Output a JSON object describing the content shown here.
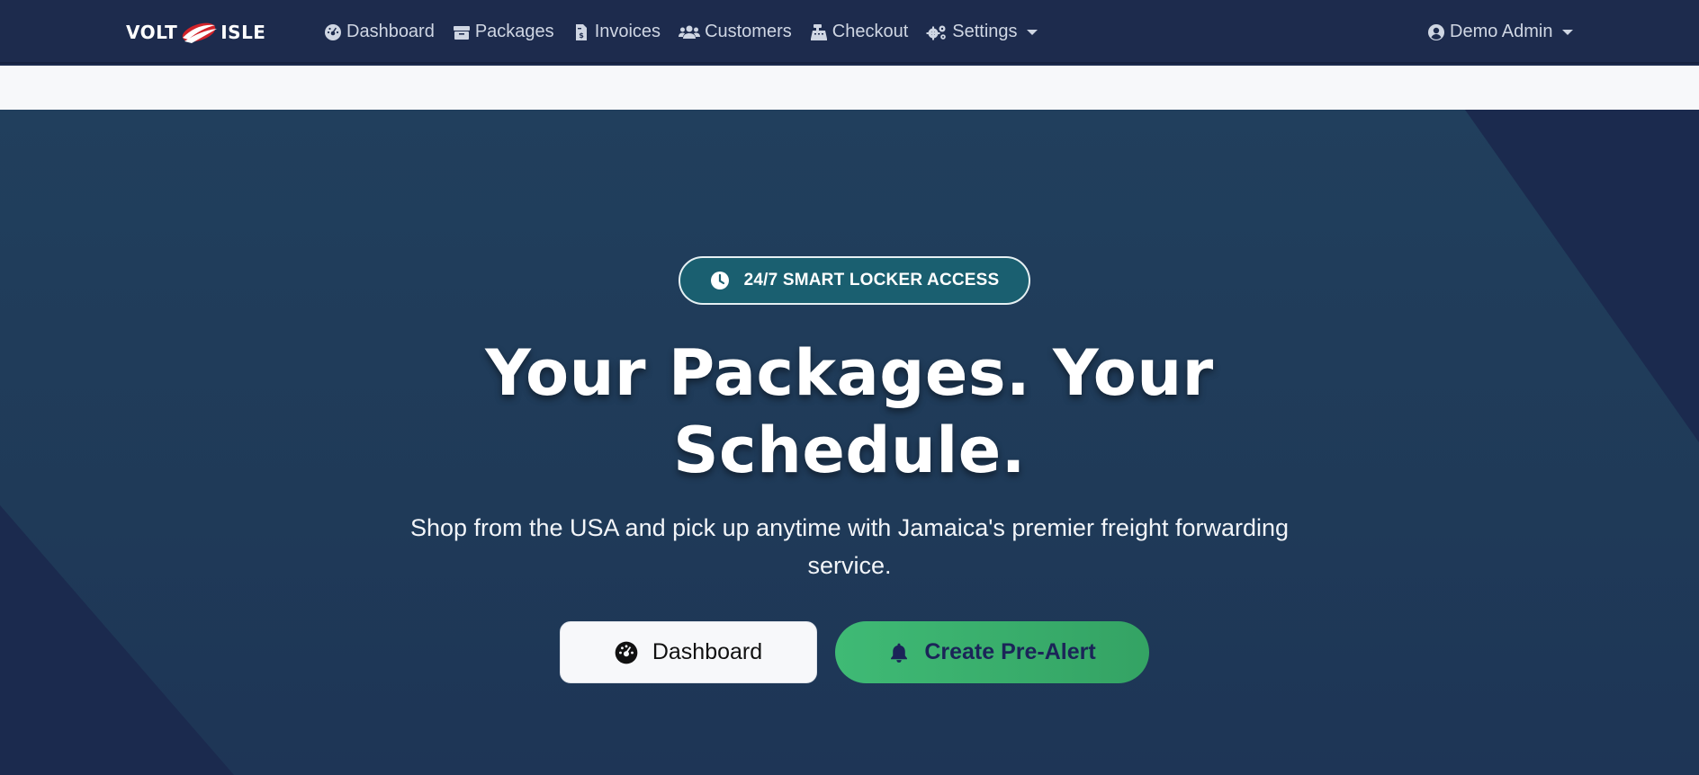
{
  "navbar": {
    "brand_left": "VOLT",
    "brand_right": "ISLE",
    "links": [
      {
        "label": "Dashboard",
        "icon": "gauge-icon"
      },
      {
        "label": "Packages",
        "icon": "box-icon"
      },
      {
        "label": "Invoices",
        "icon": "invoice-icon"
      },
      {
        "label": "Customers",
        "icon": "users-icon"
      },
      {
        "label": "Checkout",
        "icon": "cash-register-icon"
      },
      {
        "label": "Settings",
        "icon": "gears-icon"
      }
    ],
    "user": {
      "label": "Demo Admin",
      "icon": "user-circle-icon"
    }
  },
  "hero": {
    "badge": "24/7 SMART LOCKER ACCESS",
    "title_line1": "Your Packages. Your",
    "title_line2": "Schedule.",
    "subtitle_line1": "Shop from the USA and pick up anytime with Jamaica's premier freight forwarding",
    "subtitle_line2": "service.",
    "buttons": {
      "dashboard": "Dashboard",
      "pre_alert": "Create Pre-Alert"
    }
  },
  "colors": {
    "navbar_bg": "#1d2b4d",
    "hero_bg": "#213f5d",
    "badge_bg": "#1a5f70",
    "accent_green": "#3fba75",
    "brand_red": "#d2232a"
  }
}
